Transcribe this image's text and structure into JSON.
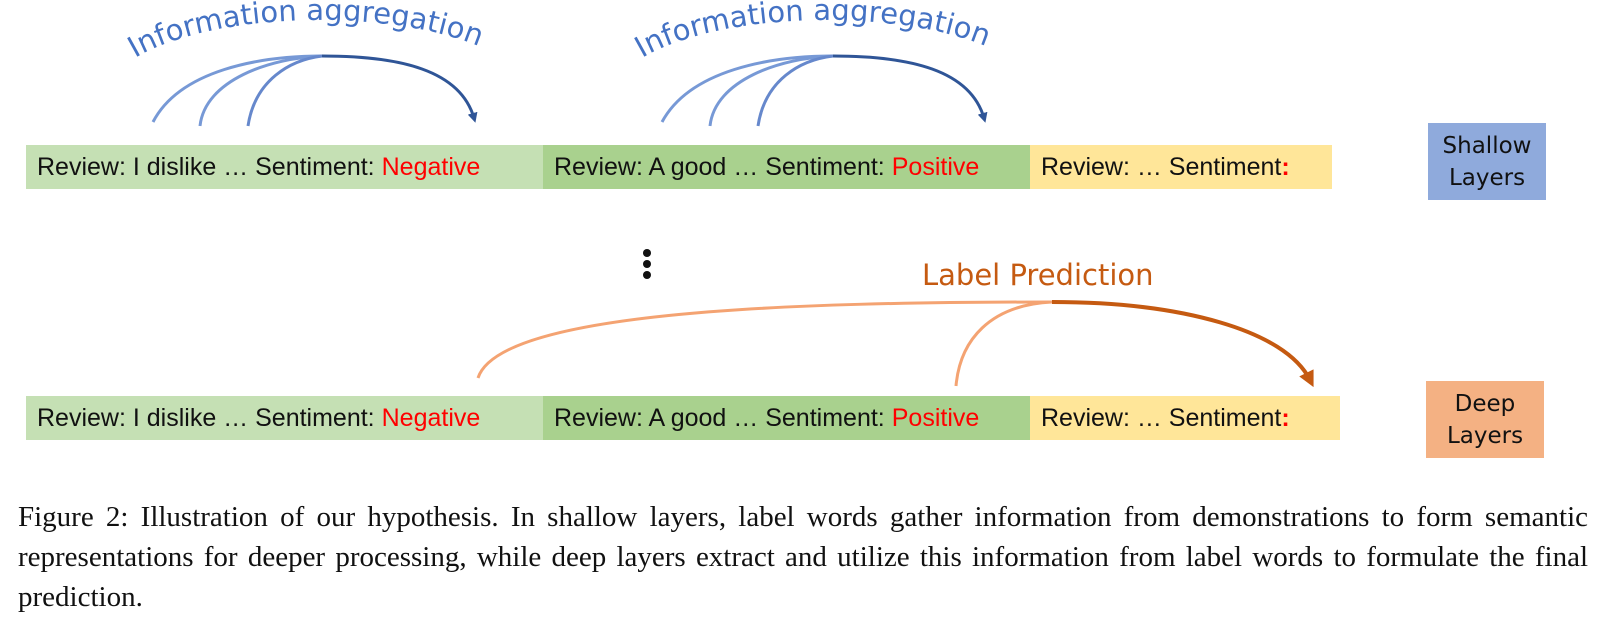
{
  "diagram": {
    "aggregation_label_1": "Information aggregation",
    "aggregation_label_2": "Information aggregation",
    "prediction_label": "Label Prediction",
    "rows": [
      {
        "id": "shallow",
        "segments": [
          {
            "prefix": "Review: I dislike … Sentiment:",
            "label": "Negative"
          },
          {
            "prefix": "Review: A good … Sentiment:",
            "label": "Positive"
          },
          {
            "prefix": "Review: … Sentiment",
            "label": ":"
          }
        ]
      },
      {
        "id": "deep",
        "segments": [
          {
            "prefix": "Review: I dislike … Sentiment:",
            "label": "Negative"
          },
          {
            "prefix": "Review: A good … Sentiment:",
            "label": "Positive"
          },
          {
            "prefix": "Review: … Sentiment",
            "label": ":"
          }
        ]
      }
    ],
    "layers": {
      "shallow": {
        "line1": "Shallow",
        "line2": "Layers"
      },
      "deep": {
        "line1": "Deep",
        "line2": "Layers"
      }
    },
    "colors": {
      "demo1": "#c5e0b4",
      "demo2": "#a9d18e",
      "query": "#ffe699",
      "label_word": "#ff0000",
      "shallow_box": "#8faadc",
      "deep_box": "#f4b183",
      "aggregation_arrow": "#2f5597",
      "aggregation_text": "#4472c4",
      "prediction_arrow": "#c55a11",
      "prediction_text": "#c55a11"
    }
  },
  "caption": "Figure 2: Illustration of our hypothesis. In shallow layers, label words gather information from demonstrations to form semantic representations for deeper processing, while deep layers extract and utilize this information from label words to formulate the final prediction."
}
